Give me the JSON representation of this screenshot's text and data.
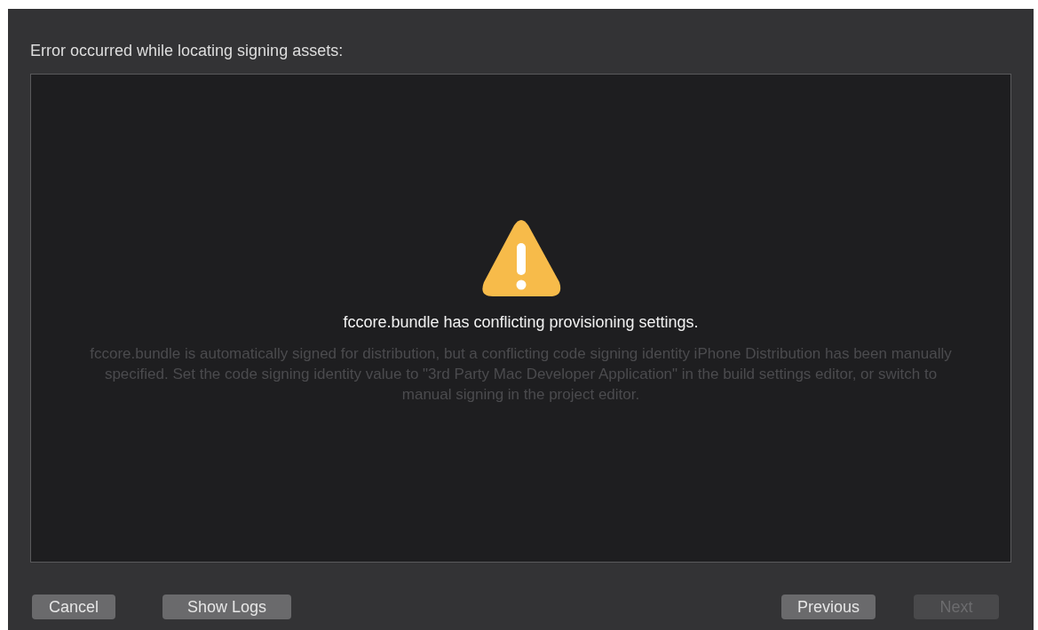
{
  "heading": "Error occurred while locating signing assets:",
  "message": {
    "title": "fccore.bundle has conflicting provisioning settings.",
    "body": "fccore.bundle is automatically signed for distribution, but a conflicting code signing identity iPhone Distribution has been manually specified. Set the code signing identity value to \"3rd Party Mac Developer Application\" in the build settings editor, or switch to manual signing in the project editor."
  },
  "buttons_left": [
    {
      "label": "Cancel",
      "disabled": false
    },
    {
      "label": "Show Logs",
      "disabled": false
    }
  ],
  "buttons_right": [
    {
      "label": "Previous",
      "disabled": false
    },
    {
      "label": "Next",
      "disabled": true
    }
  ]
}
